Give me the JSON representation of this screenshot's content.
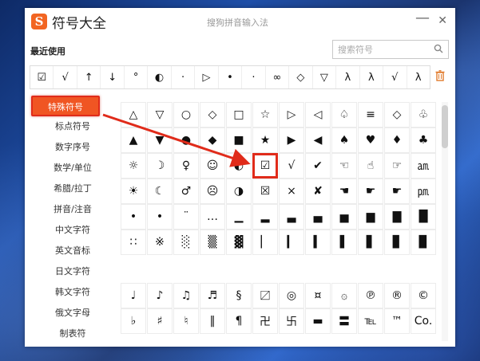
{
  "app": {
    "logo_letter": "S",
    "title": "符号大全",
    "subtitle": "搜狗拼音输入法",
    "minimize": "—",
    "close": "✕"
  },
  "recent": {
    "label": "最近使用",
    "symbols": [
      "☑",
      "√",
      "↑",
      "↓",
      "°",
      "◐",
      "·",
      "▷",
      "•",
      "·",
      "∞",
      "◇",
      "▽",
      "λ",
      "λ",
      "√",
      "λ"
    ]
  },
  "search": {
    "placeholder": "搜索符号"
  },
  "sidebar": {
    "items": [
      "特殊符号",
      "标点符号",
      "数字序号",
      "数学/单位",
      "希腊/拉丁",
      "拼音/注音",
      "中文字符",
      "英文音标",
      "日文字符",
      "韩文字符",
      "俄文字母",
      "制表符"
    ],
    "active_index": 0
  },
  "grid1": {
    "cells": [
      "△",
      "▽",
      "○",
      "◇",
      "□",
      "☆",
      "▷",
      "◁",
      "♤",
      "≡",
      "◇",
      "♧",
      "▲",
      "▼",
      "●",
      "◆",
      "■",
      "★",
      "▶",
      "◀",
      "♠",
      "♥",
      "♦",
      "♣",
      "☼",
      "☽",
      "♀",
      "☺",
      "◐",
      "☑",
      "√",
      "✔",
      "☜",
      "☝",
      "☞",
      "㏂",
      "☀",
      "☾",
      "♂",
      "☹",
      "◑",
      "☒",
      "×",
      "✘",
      "☚",
      "☛",
      "☛",
      "㏘",
      "•",
      "•",
      "¨",
      "…",
      "▁",
      "▂",
      "▃",
      "▄",
      "▅",
      "▆",
      "▇",
      "█",
      "∷",
      "※",
      "░",
      "▒",
      "▓",
      "▏",
      "▎",
      "▍",
      "▌",
      "▋",
      "▊",
      "▉"
    ],
    "selected_index": 29
  },
  "grid2": {
    "cells": [
      "♩",
      "♪",
      "♫",
      "♬",
      "§",
      "〼",
      "◎",
      "¤",
      "۞",
      "℗",
      "®",
      "©",
      "♭",
      "♯",
      "♮",
      "‖",
      "¶",
      "卍",
      "卐",
      "▬",
      "〓",
      "℡",
      "™",
      "Co."
    ]
  },
  "colors": {
    "accent": "#f05523",
    "highlight": "#e02b1a",
    "logo": "#f26522"
  }
}
